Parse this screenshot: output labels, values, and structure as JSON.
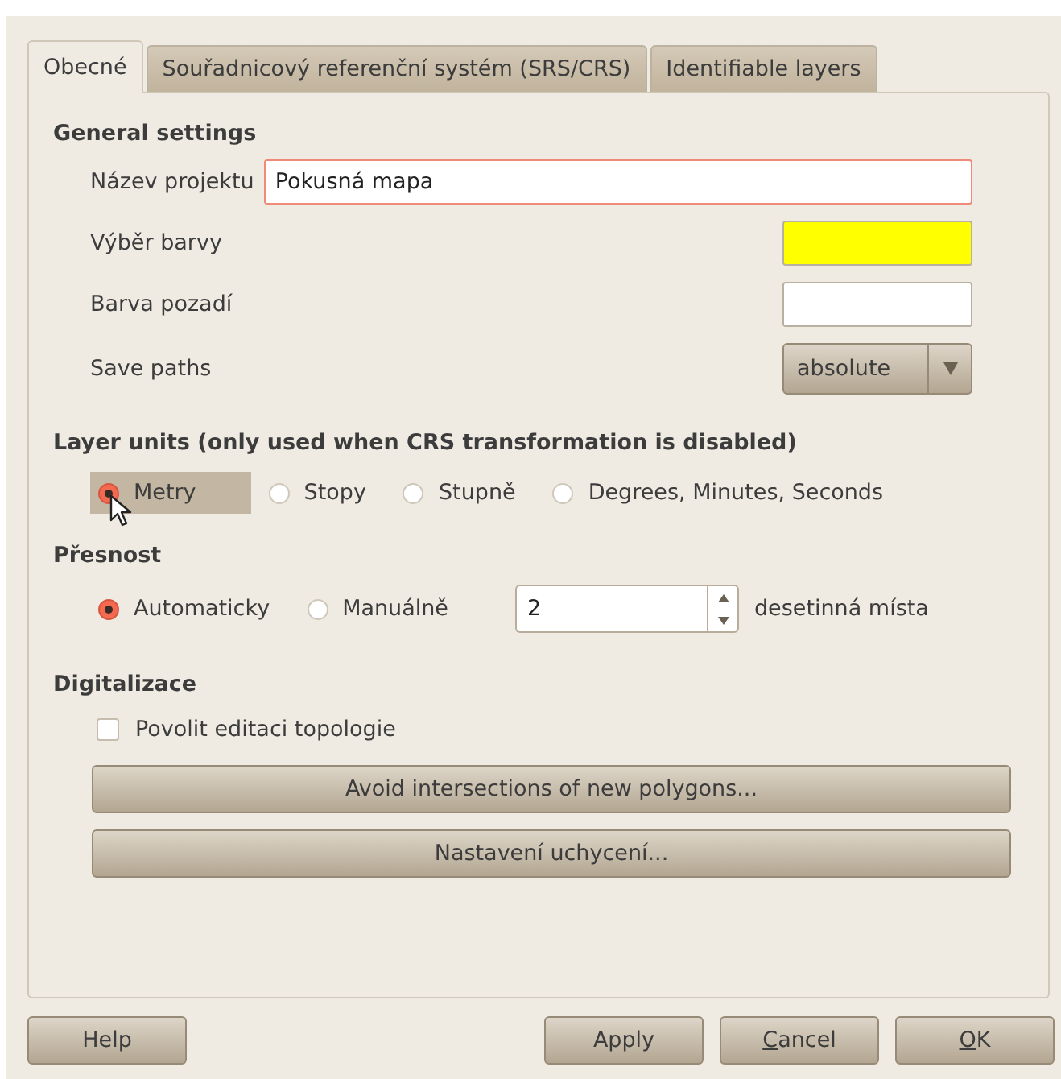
{
  "tabs": [
    {
      "label": "Obecné",
      "selected": true
    },
    {
      "label": "Souřadnicový referenční systém (SRS/CRS)",
      "selected": false
    },
    {
      "label": "Identifiable layers",
      "selected": false
    }
  ],
  "general_settings": {
    "title": "General settings",
    "project_name": {
      "label": "Název projektu",
      "value": "Pokusná mapa",
      "focused": true
    },
    "selection_color": {
      "label": "Výběr barvy",
      "color": "#ffff00"
    },
    "background_color": {
      "label": "Barva pozadí",
      "color": "#ffffff"
    },
    "save_paths": {
      "label": "Save paths",
      "value": "absolute"
    }
  },
  "layer_units": {
    "title": "Layer units (only used when CRS transformation is disabled)",
    "options": [
      {
        "label": "Metry",
        "selected": true,
        "hovered": true
      },
      {
        "label": "Stopy",
        "selected": false,
        "hovered": false
      },
      {
        "label": "Stupně",
        "selected": false,
        "hovered": false
      },
      {
        "label": "Degrees, Minutes, Seconds",
        "selected": false,
        "hovered": false
      }
    ]
  },
  "precision": {
    "title": "Přesnost",
    "options": [
      {
        "label": "Automaticky",
        "selected": true,
        "hovered": false
      },
      {
        "label": "Manuálně",
        "selected": false,
        "hovered": false
      }
    ],
    "decimal_places": {
      "value": "2",
      "suffix": "desetinná místa"
    }
  },
  "digitizing": {
    "title": "Digitalizace",
    "topology_editing": {
      "label": "Povolit editaci topologie",
      "checked": false
    },
    "buttons": [
      "Avoid intersections of new polygons...",
      "Nastavení uchycení..."
    ]
  },
  "dialog_buttons": [
    {
      "parts": [
        {
          "text": "Help",
          "underlined": false
        }
      ]
    },
    {
      "parts": [
        {
          "text": "Apply",
          "underlined": false
        }
      ]
    },
    {
      "parts": [
        {
          "text": "C",
          "underlined": true
        },
        {
          "text": "ancel",
          "underlined": false
        }
      ]
    },
    {
      "parts": [
        {
          "text": "O",
          "underlined": true
        },
        {
          "text": "K",
          "underlined": false
        }
      ]
    }
  ]
}
